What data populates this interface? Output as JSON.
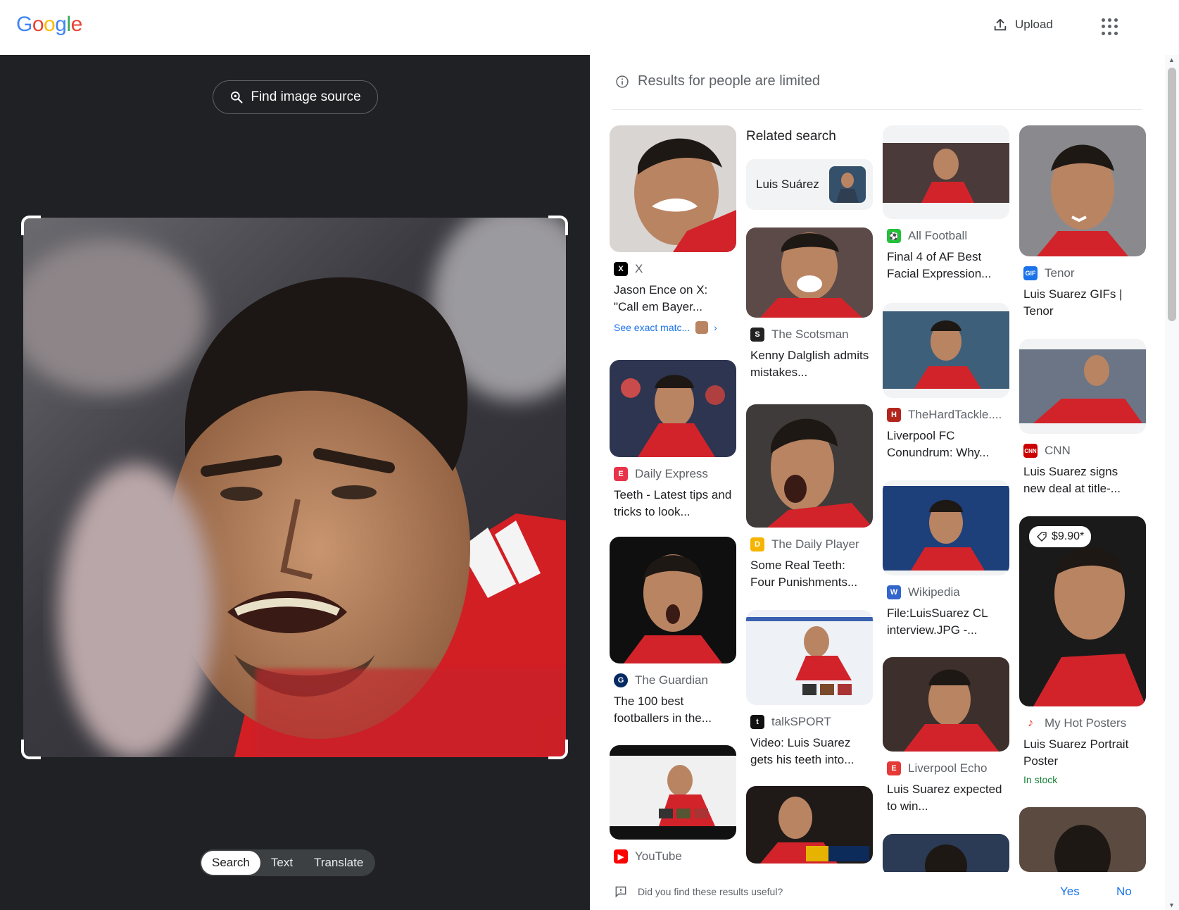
{
  "header": {
    "logo": [
      "G",
      "o",
      "o",
      "g",
      "l",
      "e"
    ],
    "logo_colors": [
      "#4285F4",
      "#EA4335",
      "#FBBC05",
      "#4285F4",
      "#34A853",
      "#EA4335"
    ],
    "upload_label": "Upload",
    "apps_icon": "apps-grid-icon"
  },
  "viewer": {
    "find_source_label": "Find image source",
    "modes": [
      "Search",
      "Text",
      "Translate"
    ],
    "active_mode": "Search"
  },
  "results": {
    "limited_notice": "Results for people are limited",
    "related_heading": "Related search",
    "related_chip": "Luis Suárez",
    "cards": [
      {
        "source": "X",
        "title": "Jason Ence on X: \"Call em Bayer...",
        "exact": "See exact matc...",
        "fav_color": "#000000",
        "fav_text": "X"
      },
      {
        "source": "Daily Express",
        "title": "Teeth - Latest tips and tricks to look...",
        "fav_color": "#e8334a",
        "fav_text": "E"
      },
      {
        "source": "The Guardian",
        "title": "The 100 best footballers in the...",
        "fav_color": "#052962",
        "fav_text": "G"
      },
      {
        "source": "YouTube",
        "fav_color": "#ff0000",
        "fav_text": "▶"
      },
      {
        "source": "The Scotsman",
        "title": "Kenny Dalglish admits mistakes...",
        "fav_color": "#222222",
        "fav_text": "S"
      },
      {
        "source": "The Daily Player",
        "title": "Some Real Teeth: Four Punishments...",
        "fav_color": "#f4b400",
        "fav_text": "D"
      },
      {
        "source": "talkSPORT",
        "title": "Video: Luis Suarez gets his teeth into...",
        "fav_color": "#111111",
        "fav_text": "t"
      },
      {
        "source": "All Football",
        "title": "Final 4 of AF Best Facial Expression...",
        "fav_color": "#21c13a",
        "fav_text": "⚽"
      },
      {
        "source": "TheHardTackle....",
        "title": "Liverpool FC Conundrum: Why...",
        "fav_color": "#b3261e",
        "fav_text": "H"
      },
      {
        "source": "Wikipedia",
        "title": "File:LuisSuarez CL interview.JPG -...",
        "fav_color": "#3366cc",
        "fav_text": "W"
      },
      {
        "source": "Liverpool Echo",
        "title": "Luis Suarez expected to win...",
        "fav_color": "#e53935",
        "fav_text": "E"
      },
      {
        "source": "Tenor",
        "title": "Luis Suarez GIFs | Tenor",
        "fav_color": "#1a73e8",
        "fav_text": "GIF"
      },
      {
        "source": "CNN",
        "title": "Luis Suarez signs new deal at title-...",
        "fav_color": "#cc0000",
        "fav_text": "CNN"
      },
      {
        "source": "My Hot Posters",
        "title": "Luis Suarez Portrait Poster",
        "price": "$9.90*",
        "stock": "In stock",
        "fav_color": "#e53935",
        "fav_text": "♪"
      }
    ]
  },
  "feedback": {
    "question": "Did you find these results useful?",
    "yes": "Yes",
    "no": "No"
  }
}
